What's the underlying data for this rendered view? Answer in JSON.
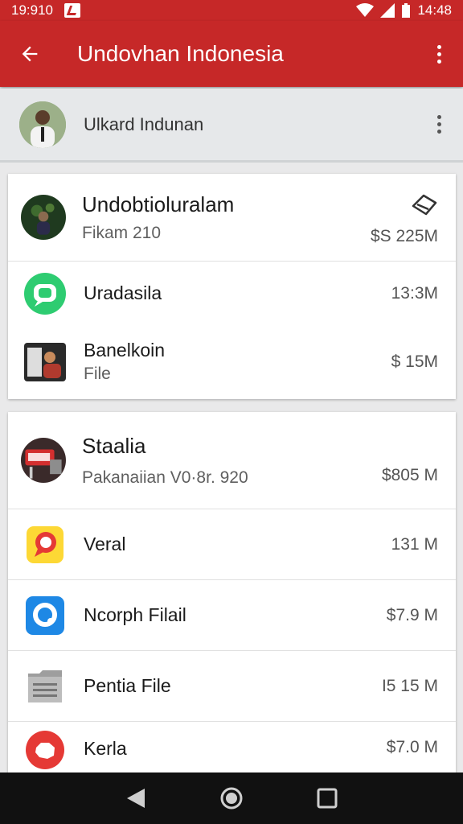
{
  "status_bar": {
    "time_left": "19:910",
    "time_right": "14:48"
  },
  "app_bar": {
    "title": "Undovhan Indonesia",
    "back_icon": "arrow-back-icon",
    "more_icon": "more-vert-icon"
  },
  "account": {
    "name": "Ulkard Indunan"
  },
  "cards": [
    {
      "items": [
        {
          "title": "Undobtioluralam",
          "subtitle": "Fikam 210",
          "size": "$S 225M",
          "icon": "photo-avatar-icon",
          "action_icon": "tag-icon"
        },
        {
          "title": "Uradasila",
          "subtitle": "",
          "size": "13:3M",
          "icon": "chat-app-icon"
        },
        {
          "title": "Banelkoin",
          "subtitle": "File",
          "size": "$ 15M",
          "icon": "photo-thumbnail-icon"
        }
      ]
    },
    {
      "items": [
        {
          "title": "Staalia",
          "subtitle": "Pakanaiian V0·8r. 920",
          "size": "$805 M",
          "icon": "sign-photo-icon"
        },
        {
          "title": "Veral",
          "subtitle": "",
          "size": "131 M",
          "icon": "map-pin-app-icon"
        },
        {
          "title": "Ncorph Filail",
          "subtitle": "",
          "size": "$7.9 M",
          "icon": "blue-app-icon"
        },
        {
          "title": "Pentia File",
          "subtitle": "",
          "size": "I5 15 M",
          "icon": "folder-icon"
        },
        {
          "title": "Kerla",
          "subtitle": "",
          "size": "$7.0 M",
          "icon": "red-app-icon"
        }
      ]
    }
  ],
  "colors": {
    "primary": "#c62828",
    "background": "#e9e9ea",
    "card": "#ffffff"
  }
}
